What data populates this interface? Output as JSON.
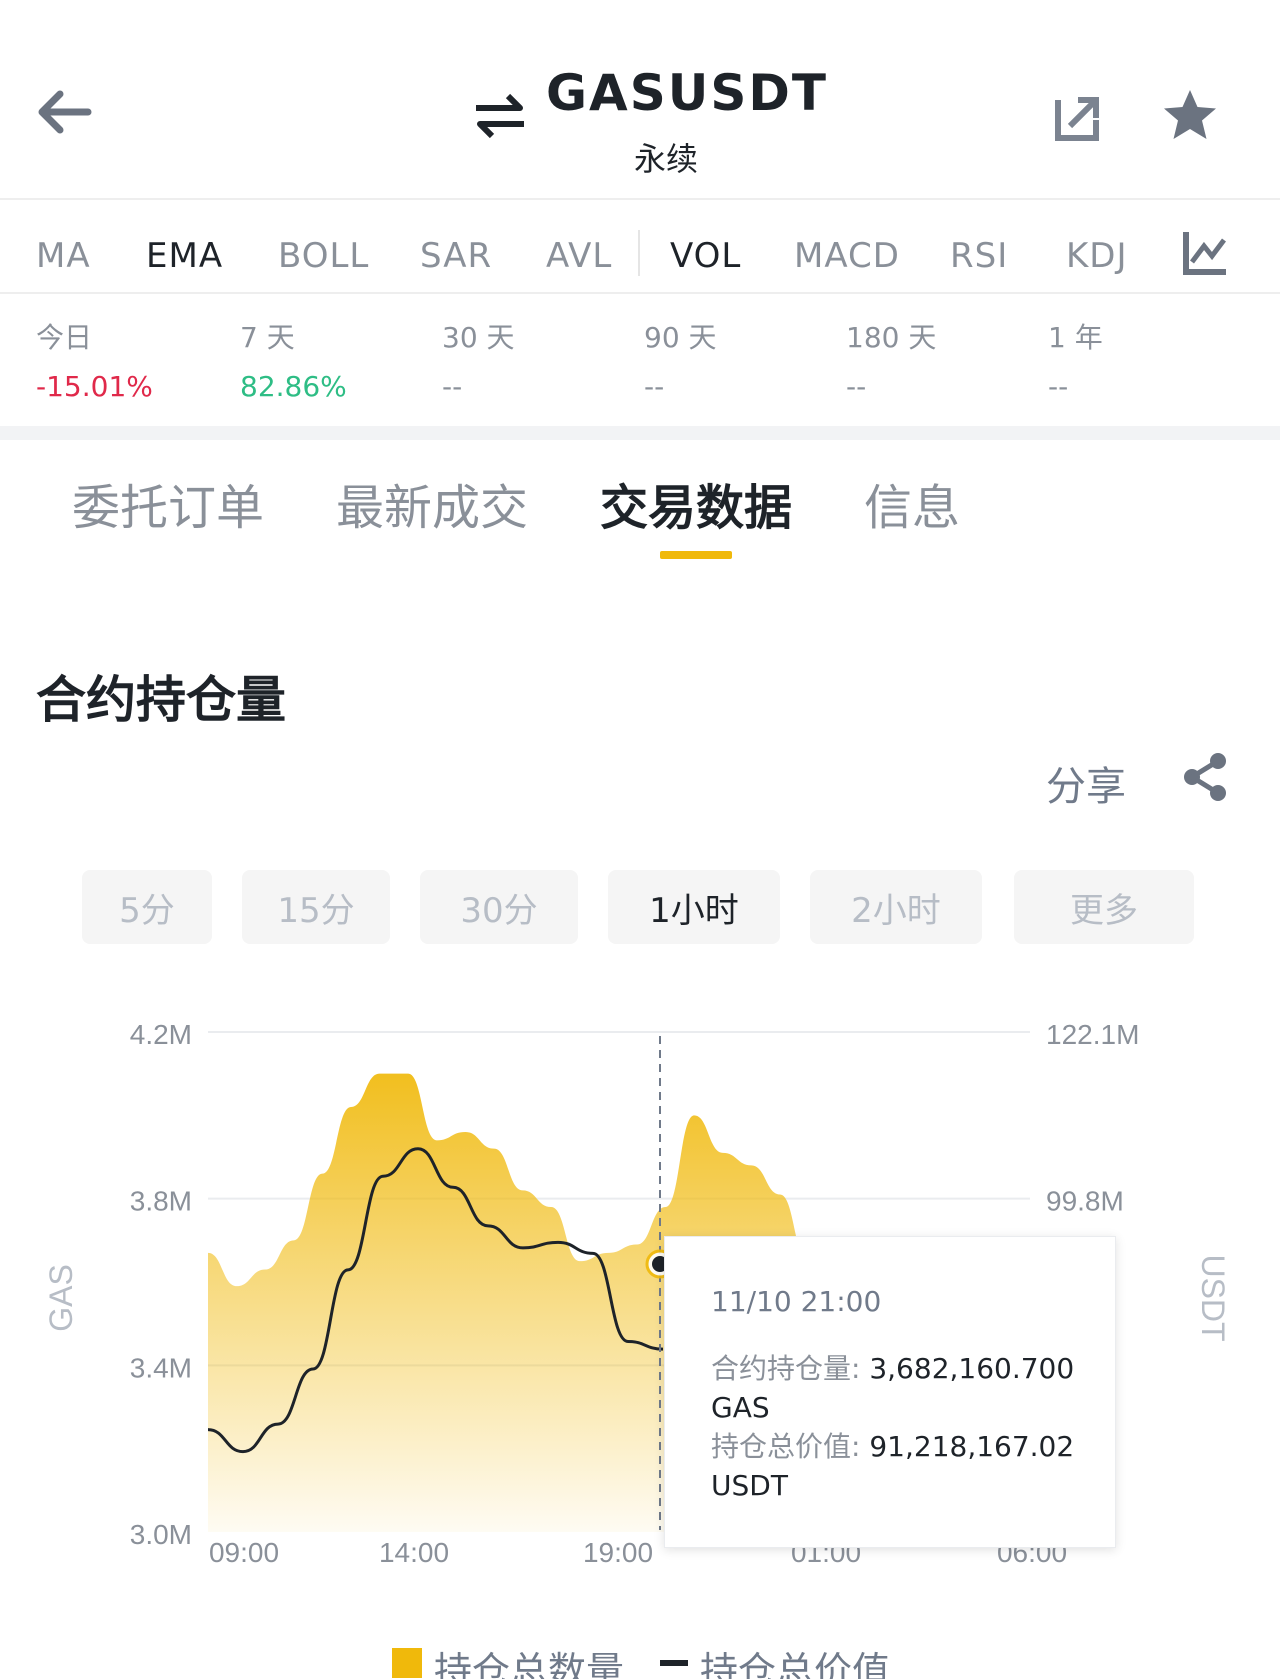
{
  "header": {
    "pair": "GASUSDT",
    "subtitle": "永续",
    "icons": {
      "back": "back-arrow-icon",
      "swap": "swap-icon",
      "share_out": "share-external-icon",
      "favorite": "star-icon"
    }
  },
  "indicators": {
    "items": [
      "MA",
      "EMA",
      "BOLL",
      "SAR",
      "AVL",
      "VOL",
      "MACD",
      "RSI",
      "KDJ"
    ],
    "active": [
      "EMA",
      "VOL"
    ],
    "settings_icon": "chart-settings-icon"
  },
  "performance": [
    {
      "label": "今日",
      "value": "-15.01%",
      "tone": "neg"
    },
    {
      "label": "7 天",
      "value": "82.86%",
      "tone": "pos"
    },
    {
      "label": "30 天",
      "value": "--",
      "tone": "none"
    },
    {
      "label": "90 天",
      "value": "--",
      "tone": "none"
    },
    {
      "label": "180 天",
      "value": "--",
      "tone": "none"
    },
    {
      "label": "1 年",
      "value": "--",
      "tone": "none"
    }
  ],
  "tabs": {
    "items": [
      "委托订单",
      "最新成交",
      "交易数据",
      "信息"
    ],
    "active": "交易数据"
  },
  "section": {
    "title": "合约持仓量",
    "share_label": "分享",
    "share_icon": "share-icon"
  },
  "timeframes": {
    "items": [
      "5分",
      "15分",
      "30分",
      "1小时",
      "2小时",
      "更多"
    ],
    "active": "1小时"
  },
  "tooltip": {
    "time": "11/10 21:00",
    "oi_label": "合约持仓量:",
    "oi_value": "3,682,160.700",
    "oi_unit": "GAS",
    "value_label": "持仓总价值:",
    "value_value": "91,218,167.02",
    "value_unit": "USDT"
  },
  "chart_data": {
    "type": "area",
    "ylabel": "GAS",
    "y2label": "USDT",
    "y_ticks": [
      "4.2M",
      "3.8M",
      "3.4M",
      "3.0M"
    ],
    "y2_ticks": [
      "122.1M",
      "99.8M"
    ],
    "x_ticks": [
      "09:00",
      "14:00",
      "19:00",
      "01:00",
      "06:00"
    ],
    "ylim": [
      3.0,
      4.2
    ],
    "y2lim": [
      76.7,
      122.1
    ],
    "accent": "#f0b90b",
    "series": [
      {
        "name": "持仓总数量",
        "kind": "area",
        "axis": "left",
        "x": [
          0,
          1,
          2,
          3,
          4,
          5,
          6,
          7,
          8,
          9,
          10,
          11,
          12,
          13,
          14,
          15,
          16,
          17,
          18,
          19,
          20,
          21
        ],
        "values": [
          3.67,
          3.59,
          3.63,
          3.7,
          3.86,
          4.02,
          4.1,
          4.1,
          3.94,
          3.96,
          3.92,
          3.82,
          3.78,
          3.65,
          3.67,
          3.69,
          3.78,
          4.0,
          3.91,
          3.88,
          3.81,
          3.65
        ]
      },
      {
        "name": "持仓总价值",
        "kind": "line",
        "axis": "right",
        "x": [
          0,
          1,
          2,
          3,
          4,
          5,
          6,
          7,
          8,
          9,
          10,
          11,
          12,
          13
        ],
        "values": [
          86.0,
          84.0,
          86.5,
          91.5,
          100.5,
          109.0,
          111.5,
          108.0,
          104.5,
          102.5,
          103.0,
          102.0,
          94.0,
          93.3
        ]
      }
    ],
    "legend": "bottom"
  }
}
